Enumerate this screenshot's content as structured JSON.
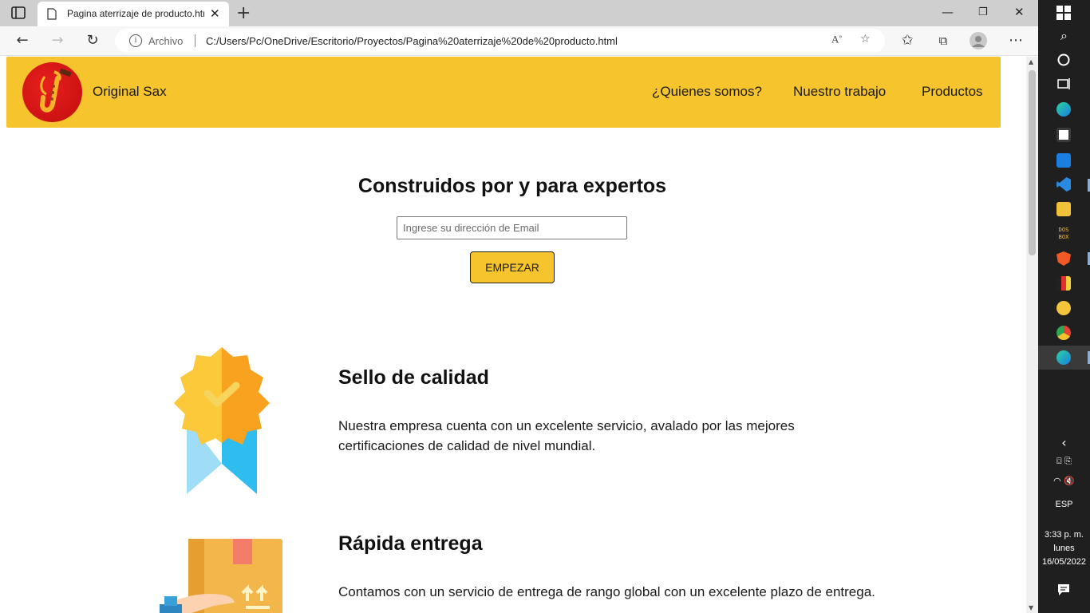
{
  "browser": {
    "tab_title": "Pagina aterrizaje de producto.htm",
    "address_label": "Archivo",
    "url": "C:/Users/Pc/OneDrive/Escritorio/Proyectos/Pagina%20aterrizaje%20de%20producto.html"
  },
  "site": {
    "brand": "Original Sax",
    "nav": [
      "¿Quienes somos?",
      "Nuestro trabajo",
      "Productos"
    ],
    "hero_title": "Construidos por y para expertos",
    "email_placeholder": "Ingrese su dirección de Email",
    "cta_label": "EMPEZAR",
    "features": [
      {
        "title": "Sello de calidad",
        "text": "Nuestra empresa cuenta con un excelente servicio, avalado por las mejores certificaciones de calidad de nivel mundial."
      },
      {
        "title": "Rápida entrega",
        "text": "Contamos con un servicio de entrega de rango global con un excelente plazo de entrega."
      }
    ]
  },
  "taskbar": {
    "language": "ESP",
    "time": "3:33 p. m.",
    "day": "lunes",
    "date": "16/05/2022"
  },
  "colors": {
    "header_yellow": "#f6c42c",
    "logo_red": "#d81515",
    "taskbar_bg": "#1f1f1f"
  }
}
